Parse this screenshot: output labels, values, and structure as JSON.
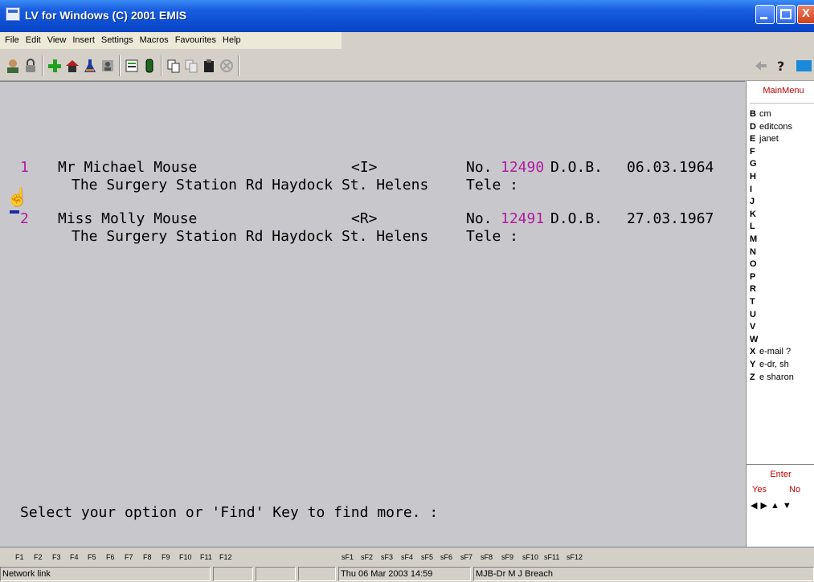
{
  "window": {
    "title": "LV for Windows (C) 2001 EMIS"
  },
  "menu": {
    "items": [
      "File",
      "Edit",
      "View",
      "Insert",
      "Settings",
      "Macros",
      "Favourites",
      "Help"
    ]
  },
  "toolbar": {
    "icons": [
      "patient-icon",
      "lock-icon",
      "add-icon",
      "house-icon",
      "flask-icon",
      "person-icon",
      "notes-icon",
      "clip-icon",
      "copy-icon",
      "paste-icon",
      "clipboard-icon",
      "cancel-icon",
      "back-arrow-icon",
      "help-icon",
      "screen-icon"
    ]
  },
  "patients": [
    {
      "index": "1",
      "name": "Mr Michael Mouse",
      "flag": "<I>",
      "no_label": "No.",
      "number": "12490",
      "dob_label": "D.O.B.",
      "dob": "06.03.1964",
      "address": "The Surgery Station Rd Haydock St. Helens",
      "tele": "Tele :"
    },
    {
      "index": "2",
      "name": "Miss Molly Mouse",
      "flag": "<R>",
      "no_label": "No.",
      "number": "12491",
      "dob_label": "D.O.B.",
      "dob": "27.03.1967",
      "address": "The Surgery Station Rd Haydock St. Helens",
      "tele": "Tele :"
    }
  ],
  "prompt": "Select your option or 'Find' Key to find more. :",
  "side_menu": {
    "title": "MainMenu",
    "items": [
      {
        "key": "B",
        "label": "cm"
      },
      {
        "key": "D",
        "label": "editcons"
      },
      {
        "key": "E",
        "label": "janet"
      },
      {
        "key": "F",
        "label": ""
      },
      {
        "key": "G",
        "label": ""
      },
      {
        "key": "H",
        "label": ""
      },
      {
        "key": "I",
        "label": ""
      },
      {
        "key": "J",
        "label": ""
      },
      {
        "key": "K",
        "label": ""
      },
      {
        "key": "L",
        "label": ""
      },
      {
        "key": "M",
        "label": ""
      },
      {
        "key": "N",
        "label": ""
      },
      {
        "key": "O",
        "label": ""
      },
      {
        "key": "P",
        "label": ""
      },
      {
        "key": "R",
        "label": ""
      },
      {
        "key": "T",
        "label": ""
      },
      {
        "key": "U",
        "label": ""
      },
      {
        "key": "V",
        "label": ""
      },
      {
        "key": "W",
        "label": ""
      },
      {
        "key": "X",
        "label": "e-mail ?"
      },
      {
        "key": "Y",
        "label": "e-dr, sh"
      },
      {
        "key": "Z",
        "label": "e sharon"
      }
    ],
    "enter_label": "Enter",
    "yes_label": "Yes",
    "no_label": "No"
  },
  "function_keys": [
    "F1",
    "F2",
    "F3",
    "F4",
    "F5",
    "F6",
    "F7",
    "F8",
    "F9",
    "F10",
    "F11",
    "F12",
    "sF1",
    "sF2",
    "sF3",
    "sF4",
    "sF5",
    "sF6",
    "sF7",
    "sF8",
    "sF9",
    "sF10",
    "sF11",
    "sF12"
  ],
  "status": {
    "connection": "Network link",
    "datetime": "Thu 06 Mar 2003 14:59",
    "user": "MJB-Dr M J Breach"
  }
}
